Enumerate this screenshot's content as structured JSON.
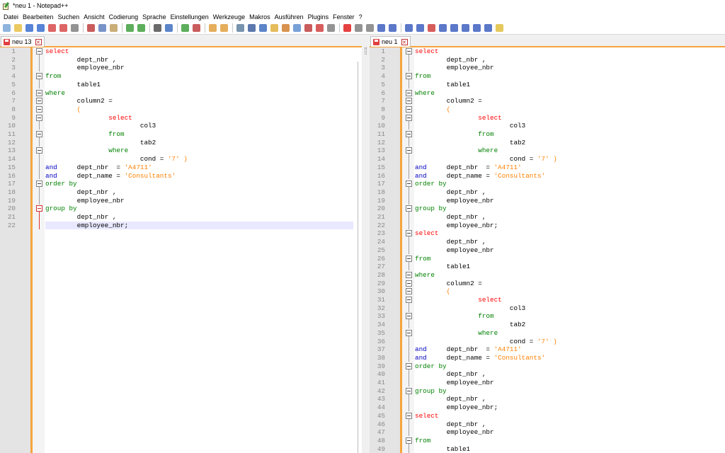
{
  "window": {
    "title": "*neu 1 - Notepad++"
  },
  "menu": [
    "Datei",
    "Bearbeiten",
    "Suchen",
    "Ansicht",
    "Codierung",
    "Sprache",
    "Einstellungen",
    "Werkzeuge",
    "Makros",
    "Ausführen",
    "Plugins",
    "Fenster",
    "?"
  ],
  "toolbar": {
    "icons": [
      {
        "name": "new-file-icon",
        "color": "#7aa7d8"
      },
      {
        "name": "open-file-icon",
        "color": "#e8c048"
      },
      {
        "name": "save-icon",
        "color": "#3a6fd0"
      },
      {
        "name": "save-all-icon",
        "color": "#3a6fd0"
      },
      {
        "name": "close-icon",
        "color": "#d84a4a"
      },
      {
        "name": "close-all-icon",
        "color": "#d84a4a"
      },
      {
        "name": "print-icon",
        "color": "#808080"
      },
      {
        "sep": true
      },
      {
        "name": "cut-icon",
        "color": "#c04040"
      },
      {
        "name": "copy-icon",
        "color": "#6080c0"
      },
      {
        "name": "paste-icon",
        "color": "#c0a060"
      },
      {
        "sep": true
      },
      {
        "name": "undo-icon",
        "color": "#40a040"
      },
      {
        "name": "redo-icon",
        "color": "#40a040"
      },
      {
        "sep": true
      },
      {
        "name": "find-icon",
        "color": "#505050"
      },
      {
        "name": "replace-icon",
        "color": "#4070c0"
      },
      {
        "sep": true
      },
      {
        "name": "zoom-in-icon",
        "color": "#40a040"
      },
      {
        "name": "zoom-out-icon",
        "color": "#c04040"
      },
      {
        "sep": true
      },
      {
        "name": "sync-vertical-icon",
        "color": "#e0a040"
      },
      {
        "name": "sync-horizontal-icon",
        "color": "#e0a040"
      },
      {
        "sep": true
      },
      {
        "name": "word-wrap-icon",
        "color": "#6080a0"
      },
      {
        "name": "show-all-chars-icon",
        "color": "#4060a0"
      },
      {
        "name": "indent-guide-icon",
        "color": "#4070c0"
      },
      {
        "name": "udl-icon",
        "color": "#e0b040"
      },
      {
        "name": "doc-map-icon",
        "color": "#d08030"
      },
      {
        "name": "function-list-icon",
        "color": "#6090d0"
      },
      {
        "name": "folder-workspace-icon",
        "color": "#c04040"
      },
      {
        "name": "monitor-icon",
        "color": "#d04040"
      },
      {
        "name": "record-circle-icon",
        "color": "#808080"
      },
      {
        "sep": true
      },
      {
        "name": "macro-record-icon",
        "color": "#e02020"
      },
      {
        "name": "macro-stop-icon",
        "color": "#808080"
      },
      {
        "name": "macro-play-icon",
        "color": "#808080"
      },
      {
        "name": "macro-run-multiple-icon",
        "color": "#4060c0"
      },
      {
        "name": "macro-save-icon",
        "color": "#4060c0"
      },
      {
        "sep": true
      },
      {
        "name": "compare-icon",
        "color": "#4060c0"
      },
      {
        "name": "compare-panel-icon",
        "color": "#4060c0"
      },
      {
        "name": "compare-diff-icon",
        "color": "#d04040"
      },
      {
        "name": "first-diff-icon",
        "color": "#4060c0"
      },
      {
        "name": "prev-diff-icon",
        "color": "#4060c0"
      },
      {
        "name": "next-diff-icon",
        "color": "#4060c0"
      },
      {
        "name": "last-diff-icon",
        "color": "#4060c0"
      },
      {
        "name": "compare-nav-icon",
        "color": "#4060c0"
      },
      {
        "name": "sql-format-icon",
        "color": "#e0c040"
      }
    ]
  },
  "left_tab": {
    "label": "neu 13"
  },
  "right_tab": {
    "label": "neu 1"
  },
  "left_lines": [
    {
      "n": "1",
      "fold": "box",
      "segs": [
        [
          "select",
          "kw-red"
        ]
      ]
    },
    {
      "n": "2",
      "segs": [
        [
          "        dept_nbr ,",
          ""
        ]
      ]
    },
    {
      "n": "3",
      "segs": [
        [
          "        employee_nbr",
          ""
        ]
      ]
    },
    {
      "n": "4",
      "fold": "box",
      "segs": [
        [
          "from",
          "kw-green"
        ]
      ]
    },
    {
      "n": "5",
      "segs": [
        [
          "        table1",
          ""
        ]
      ]
    },
    {
      "n": "6",
      "fold": "box",
      "segs": [
        [
          "where",
          "kw-green"
        ]
      ]
    },
    {
      "n": "7",
      "fold": "box",
      "segs": [
        [
          "        column2 =",
          ""
        ]
      ]
    },
    {
      "n": "8",
      "fold": "box",
      "segs": [
        [
          "        ",
          ""
        ],
        [
          "(",
          "str2"
        ]
      ]
    },
    {
      "n": "9",
      "fold": "box",
      "segs": [
        [
          "                ",
          ""
        ],
        [
          "select",
          "kw-red"
        ]
      ]
    },
    {
      "n": "10",
      "segs": [
        [
          "                        col3",
          ""
        ]
      ]
    },
    {
      "n": "11",
      "fold": "box",
      "segs": [
        [
          "                ",
          ""
        ],
        [
          "from",
          "kw-green"
        ]
      ]
    },
    {
      "n": "12",
      "segs": [
        [
          "                        tab2",
          ""
        ]
      ]
    },
    {
      "n": "13",
      "fold": "box",
      "segs": [
        [
          "                ",
          ""
        ],
        [
          "where",
          "kw-green"
        ]
      ]
    },
    {
      "n": "14",
      "segs": [
        [
          "                        cond = ",
          ""
        ],
        [
          "'7' )",
          "str2"
        ]
      ]
    },
    {
      "n": "15",
      "segs": [
        [
          "and",
          "kw-blue"
        ],
        [
          "     dept_nbr  = ",
          ""
        ],
        [
          "'A4711'",
          "str2"
        ]
      ]
    },
    {
      "n": "16",
      "segs": [
        [
          "and",
          "kw-blue"
        ],
        [
          "     dept_name = ",
          ""
        ],
        [
          "'Consultants'",
          "str2"
        ]
      ]
    },
    {
      "n": "17",
      "fold": "box",
      "segs": [
        [
          "order by",
          "kw-green"
        ]
      ]
    },
    {
      "n": "18",
      "segs": [
        [
          "        dept_nbr ,",
          ""
        ]
      ]
    },
    {
      "n": "19",
      "segs": [
        [
          "        employee_nbr",
          ""
        ]
      ]
    },
    {
      "n": "20",
      "fold": "red",
      "segs": [
        [
          "group by",
          "kw-green"
        ]
      ]
    },
    {
      "n": "21",
      "segs": [
        [
          "        dept_nbr ,",
          ""
        ]
      ]
    },
    {
      "n": "22",
      "current": true,
      "segs": [
        [
          "        employee_nbr;",
          ""
        ]
      ]
    }
  ],
  "right_lines": [
    {
      "n": "1",
      "fold": "box",
      "segs": [
        [
          "select",
          "kw-red"
        ]
      ]
    },
    {
      "n": "2",
      "segs": [
        [
          "        dept_nbr ,",
          ""
        ]
      ]
    },
    {
      "n": "3",
      "segs": [
        [
          "        employee_nbr",
          ""
        ]
      ]
    },
    {
      "n": "4",
      "fold": "box",
      "segs": [
        [
          "from",
          "kw-green"
        ]
      ]
    },
    {
      "n": "5",
      "segs": [
        [
          "        table1",
          ""
        ]
      ]
    },
    {
      "n": "6",
      "fold": "box",
      "segs": [
        [
          "where",
          "kw-green"
        ]
      ]
    },
    {
      "n": "7",
      "fold": "box",
      "segs": [
        [
          "        column2 =",
          ""
        ]
      ]
    },
    {
      "n": "8",
      "fold": "box",
      "segs": [
        [
          "        ",
          ""
        ],
        [
          "(",
          "str2"
        ]
      ]
    },
    {
      "n": "9",
      "fold": "box",
      "segs": [
        [
          "                ",
          ""
        ],
        [
          "select",
          "kw-red"
        ]
      ]
    },
    {
      "n": "10",
      "segs": [
        [
          "                        col3",
          ""
        ]
      ]
    },
    {
      "n": "11",
      "fold": "box",
      "segs": [
        [
          "                ",
          ""
        ],
        [
          "from",
          "kw-green"
        ]
      ]
    },
    {
      "n": "12",
      "segs": [
        [
          "                        tab2",
          ""
        ]
      ]
    },
    {
      "n": "13",
      "fold": "box",
      "segs": [
        [
          "                ",
          ""
        ],
        [
          "where",
          "kw-green"
        ]
      ]
    },
    {
      "n": "14",
      "segs": [
        [
          "                        cond = ",
          ""
        ],
        [
          "'7' )",
          "str2"
        ]
      ]
    },
    {
      "n": "15",
      "segs": [
        [
          "and",
          "kw-blue"
        ],
        [
          "     dept_nbr  = ",
          ""
        ],
        [
          "'A4711'",
          "str2"
        ]
      ]
    },
    {
      "n": "16",
      "segs": [
        [
          "and",
          "kw-blue"
        ],
        [
          "     dept_name = ",
          ""
        ],
        [
          "'Consultants'",
          "str2"
        ]
      ]
    },
    {
      "n": "17",
      "fold": "box",
      "segs": [
        [
          "order by",
          "kw-green"
        ]
      ]
    },
    {
      "n": "18",
      "segs": [
        [
          "        dept_nbr ,",
          ""
        ]
      ]
    },
    {
      "n": "19",
      "segs": [
        [
          "        employee_nbr",
          ""
        ]
      ]
    },
    {
      "n": "20",
      "fold": "box",
      "segs": [
        [
          "group by",
          "kw-green"
        ]
      ]
    },
    {
      "n": "21",
      "segs": [
        [
          "        dept_nbr ,",
          ""
        ]
      ]
    },
    {
      "n": "22",
      "segs": [
        [
          "        employee_nbr;",
          ""
        ]
      ]
    },
    {
      "n": "23",
      "fold": "box",
      "segs": [
        [
          "select",
          "kw-red"
        ]
      ]
    },
    {
      "n": "24",
      "segs": [
        [
          "        dept_nbr ,",
          ""
        ]
      ]
    },
    {
      "n": "25",
      "segs": [
        [
          "        employee_nbr",
          ""
        ]
      ]
    },
    {
      "n": "26",
      "fold": "box",
      "segs": [
        [
          "from",
          "kw-green"
        ]
      ]
    },
    {
      "n": "27",
      "segs": [
        [
          "        table1",
          ""
        ]
      ]
    },
    {
      "n": "28",
      "fold": "box",
      "segs": [
        [
          "where",
          "kw-green"
        ]
      ]
    },
    {
      "n": "29",
      "fold": "box",
      "segs": [
        [
          "        column2 =",
          ""
        ]
      ]
    },
    {
      "n": "30",
      "fold": "box",
      "segs": [
        [
          "        ",
          ""
        ],
        [
          "(",
          "str2"
        ]
      ]
    },
    {
      "n": "31",
      "fold": "box",
      "segs": [
        [
          "                ",
          ""
        ],
        [
          "select",
          "kw-red"
        ]
      ]
    },
    {
      "n": "32",
      "segs": [
        [
          "                        col3",
          ""
        ]
      ]
    },
    {
      "n": "33",
      "fold": "box",
      "segs": [
        [
          "                ",
          ""
        ],
        [
          "from",
          "kw-green"
        ]
      ]
    },
    {
      "n": "34",
      "segs": [
        [
          "                        tab2",
          ""
        ]
      ]
    },
    {
      "n": "35",
      "fold": "box",
      "segs": [
        [
          "                ",
          ""
        ],
        [
          "where",
          "kw-green"
        ]
      ]
    },
    {
      "n": "36",
      "segs": [
        [
          "                        cond = ",
          ""
        ],
        [
          "'7' )",
          "str2"
        ]
      ]
    },
    {
      "n": "37",
      "segs": [
        [
          "and",
          "kw-blue"
        ],
        [
          "     dept_nbr  = ",
          ""
        ],
        [
          "'A4711'",
          "str2"
        ]
      ]
    },
    {
      "n": "38",
      "segs": [
        [
          "and",
          "kw-blue"
        ],
        [
          "     dept_name = ",
          ""
        ],
        [
          "'Consultants'",
          "str2"
        ]
      ]
    },
    {
      "n": "39",
      "fold": "box",
      "segs": [
        [
          "order by",
          "kw-green"
        ]
      ]
    },
    {
      "n": "40",
      "segs": [
        [
          "        dept_nbr ,",
          ""
        ]
      ]
    },
    {
      "n": "41",
      "segs": [
        [
          "        employee_nbr",
          ""
        ]
      ]
    },
    {
      "n": "42",
      "fold": "box",
      "segs": [
        [
          "group by",
          "kw-green"
        ]
      ]
    },
    {
      "n": "43",
      "segs": [
        [
          "        dept_nbr ,",
          ""
        ]
      ]
    },
    {
      "n": "44",
      "segs": [
        [
          "        employee_nbr;",
          ""
        ]
      ]
    },
    {
      "n": "45",
      "fold": "box",
      "segs": [
        [
          "select",
          "kw-red"
        ]
      ]
    },
    {
      "n": "46",
      "segs": [
        [
          "        dept_nbr ,",
          ""
        ]
      ]
    },
    {
      "n": "47",
      "segs": [
        [
          "        employee_nbr",
          ""
        ]
      ]
    },
    {
      "n": "48",
      "fold": "box",
      "segs": [
        [
          "from",
          "kw-green"
        ]
      ]
    },
    {
      "n": "49",
      "segs": [
        [
          "        table1",
          ""
        ]
      ]
    }
  ]
}
